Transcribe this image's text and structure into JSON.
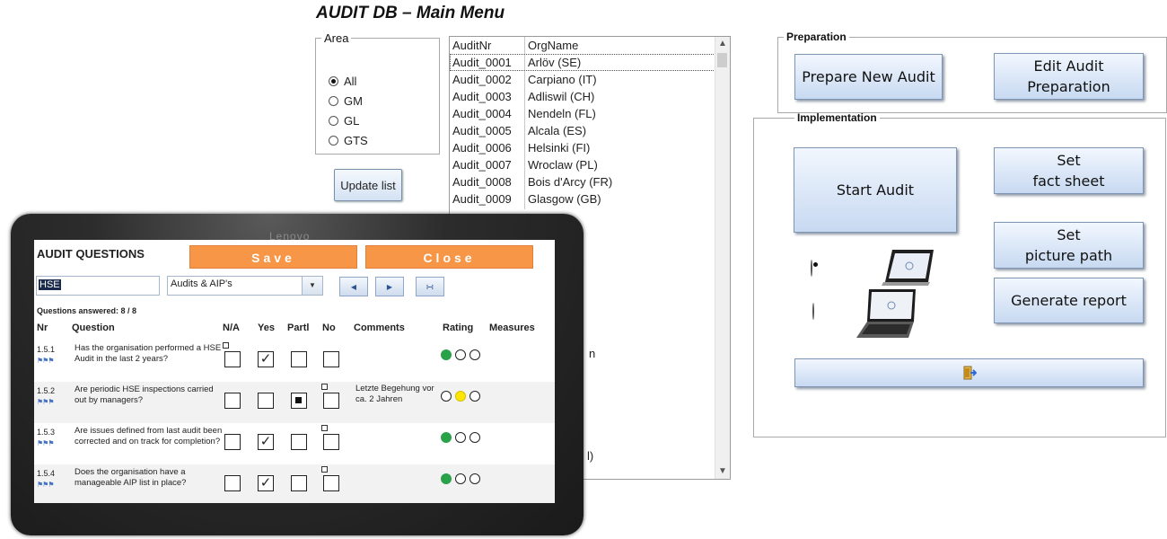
{
  "title": "AUDIT DB – Main Menu",
  "area": {
    "legend": "Area",
    "options": [
      "All",
      "GM",
      "GL",
      "GTS"
    ],
    "selected": "All"
  },
  "update_button": "Update list",
  "audit_list": {
    "headers": [
      "AuditNr",
      "OrgName"
    ],
    "rows": [
      [
        "Audit_0001",
        "Arlöv (SE)"
      ],
      [
        "Audit_0002",
        "Carpiano (IT)"
      ],
      [
        "Audit_0003",
        "Adliswil (CH)"
      ],
      [
        "Audit_0004",
        "Nendeln (FL)"
      ],
      [
        "Audit_0005",
        "Alcala (ES)"
      ],
      [
        "Audit_0006",
        "Helsinki (FI)"
      ],
      [
        "Audit_0007",
        "Wroclaw (PL)"
      ],
      [
        "Audit_0008",
        "Bois d'Arcy (FR)"
      ],
      [
        "Audit_0009",
        "Glasgow (GB)"
      ]
    ],
    "selected_row": 0,
    "partial_fragments": [
      "n",
      "l)"
    ]
  },
  "preparation": {
    "legend": "Preparation",
    "prepare_new": "Prepare New Audit",
    "edit_prep": "Edit Audit\nPreparation"
  },
  "implementation": {
    "legend": "Implementation",
    "start_audit": "Start Audit",
    "set_fact_sheet": "Set\nfact sheet",
    "set_picture_path": "Set\npicture path",
    "generate_report": "Generate report",
    "device_selected": "tablet"
  },
  "tablet": {
    "brand": "Lenovo",
    "heading": "AUDIT QUESTIONS",
    "save": "Save",
    "close": "Close",
    "filter1": "HSE",
    "filter2": "Audits & AIP's",
    "answered": "Questions answered: 8 / 8",
    "columns": [
      "Nr",
      "Question",
      "N/A",
      "Yes",
      "Partl",
      "No",
      "Comments",
      "Rating",
      "Measures"
    ],
    "questions": [
      {
        "nr": "1.5.1",
        "text": "Has the organisation performed a HSE Audit in the last 2 years?",
        "answer": "Yes",
        "comment": "",
        "rating": "green"
      },
      {
        "nr": "1.5.2",
        "text": "Are periodic HSE inspections carried out by managers?",
        "answer": "Partl",
        "comment": "Letzte Begehung vor ca. 2 Jahren",
        "rating": "yellow"
      },
      {
        "nr": "1.5.3",
        "text": "Are issues defined from last audit been corrected and on track for completion?",
        "answer": "Yes",
        "comment": "",
        "rating": "green"
      },
      {
        "nr": "1.5.4",
        "text": "Does the organisation have a manageable AIP list in place?",
        "answer": "Yes",
        "comment": "",
        "rating": "green"
      }
    ]
  },
  "icons": {
    "radio": "radio-icon",
    "scroll_up": "chevron-up-icon",
    "scroll_down": "chevron-down-icon",
    "exit": "exit-door-icon",
    "tablet_device": "tablet-device-icon",
    "laptop_device": "laptop-device-icon",
    "nav_prev": "arrow-left-icon",
    "nav_next": "arrow-right-icon",
    "nav_filter": "binoculars-icon"
  },
  "colors": {
    "accent_orange": "#f79646",
    "button_blue": "#c7d9f1",
    "rating_green": "#2aa24a",
    "rating_yellow": "#ffe600"
  }
}
